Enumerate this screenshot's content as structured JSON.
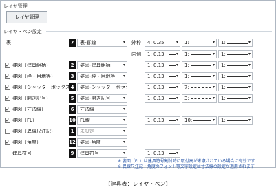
{
  "layer_mgmt": {
    "title": "レイヤ管理",
    "button": "レイヤ管理"
  },
  "settings": {
    "title": "レイヤ・ペン設定"
  },
  "table_row": {
    "label": "表",
    "num": "7",
    "layer": "表-罫線",
    "outer": {
      "label": "外枠",
      "width": "4: 0.35",
      "type": "1:",
      "scale": "1:"
    },
    "inner": {
      "label": "内側",
      "width": "1: 0.13",
      "type": "1:",
      "scale": "1:"
    }
  },
  "rows": [
    {
      "checked": true,
      "label": "姿図（建具組柄）",
      "num": "2",
      "layer": "姿図-建具組柄",
      "width": "1: 0.13",
      "type": "1:",
      "scale": "1:"
    },
    {
      "checked": true,
      "label": "姿図（枠・目地等）",
      "num": "3",
      "layer": "姿図-枠・目地等",
      "width": "1: 0.13",
      "type": "1:",
      "scale": "1:"
    },
    {
      "checked": true,
      "label": "姿図（シャッターボックス）",
      "num": "4",
      "layer": "姿図-シャッターボックス",
      "width": "1: 0.13",
      "type": "7:",
      "scale": "1:"
    },
    {
      "checked": true,
      "label": "姿図（開き記号）",
      "num": "5",
      "layer": "姿図-開き記号",
      "width": "1: 0.13",
      "type": "3:",
      "scale": "1:"
    },
    {
      "checked": true,
      "label": "姿図（寸法線）",
      "num": "6",
      "layer": "寸法線"
    },
    {
      "checked": true,
      "label": "姿図（FL）",
      "num": "10",
      "layer": "FL線",
      "width": "1: 0.13",
      "type": "10:",
      "scale": "1:"
    },
    {
      "checked": false,
      "label": "姿図（異線尺注記）",
      "num": "1",
      "layer": "未設定",
      "grey": true
    },
    {
      "checked": true,
      "label": "姿図（角度）",
      "num": "12",
      "layer": "姿図-角度"
    },
    {
      "checked": null,
      "label": "建具符号",
      "num": "9",
      "layer": "建具符号",
      "width": "1: 0.13"
    }
  ],
  "notes": [
    "※ 姿図（FL）は建具符号割付時に取付高が考慮されている場合に有効です",
    "※ 異線尺注記・角度のフォント等文字設定は寸法線の設定が適用されます"
  ],
  "caption": "【建具表：レイヤ・ペン】"
}
